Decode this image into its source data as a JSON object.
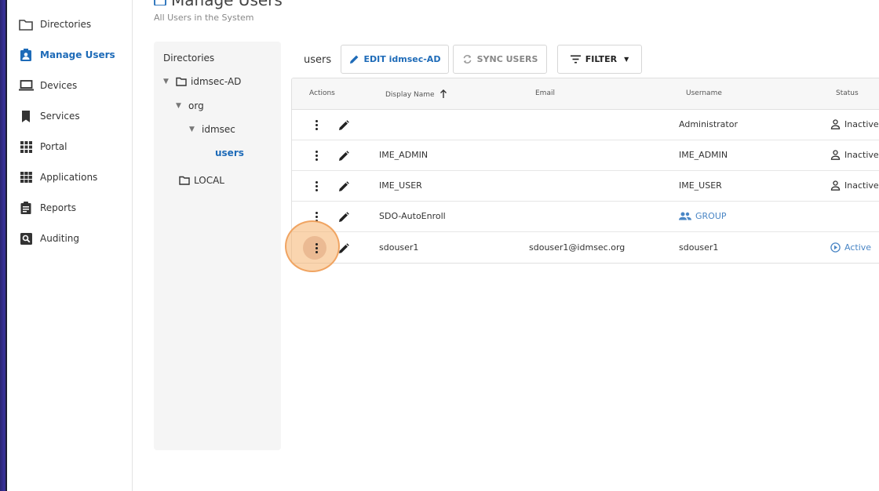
{
  "sidebar": {
    "items": [
      {
        "label": "Directories",
        "icon": "folder-icon"
      },
      {
        "label": "Manage Users",
        "icon": "user-badge-icon",
        "active": true
      },
      {
        "label": "Devices",
        "icon": "laptop-icon"
      },
      {
        "label": "Services",
        "icon": "bookmark-icon"
      },
      {
        "label": "Portal",
        "icon": "grid-icon"
      },
      {
        "label": "Applications",
        "icon": "apps-icon"
      },
      {
        "label": "Reports",
        "icon": "clipboard-icon"
      },
      {
        "label": "Auditing",
        "icon": "search-box-icon"
      }
    ]
  },
  "header": {
    "title": "Manage Users",
    "subtitle": "All Users in the System"
  },
  "tree": {
    "title": "Directories",
    "nodes": [
      {
        "label": "idmsec-AD"
      },
      {
        "label": "org"
      },
      {
        "label": "idmsec"
      },
      {
        "label": "users"
      },
      {
        "label": "LOCAL"
      }
    ]
  },
  "toolbar": {
    "current": "users",
    "edit_label": "EDIT idmsec-AD",
    "sync_label": "SYNC USERS",
    "filter_label": "FILTER"
  },
  "table": {
    "columns": [
      "Actions",
      "Display Name",
      "Email",
      "Username",
      "Status"
    ],
    "sort_column": "Display Name",
    "sort_direction": "ascending",
    "rows": [
      {
        "display_name": "",
        "email": "",
        "username": "Administrator",
        "status": "Inactive"
      },
      {
        "display_name": "IME_ADMIN",
        "email": "",
        "username": "IME_ADMIN",
        "status": "Inactive"
      },
      {
        "display_name": "IME_USER",
        "email": "",
        "username": "IME_USER",
        "status": "Inactive"
      },
      {
        "display_name": "SDO-AutoEnroll",
        "email": "",
        "username": "GROUP",
        "status": ""
      },
      {
        "display_name": "sdouser1",
        "email": "sdouser1@idmsec.org",
        "username": "sdouser1",
        "status": "Active"
      }
    ]
  },
  "colors": {
    "accent": "#1e6bb8",
    "link": "#4a86c5",
    "disabled": "#888888",
    "click_highlight": "#f6b26e"
  }
}
